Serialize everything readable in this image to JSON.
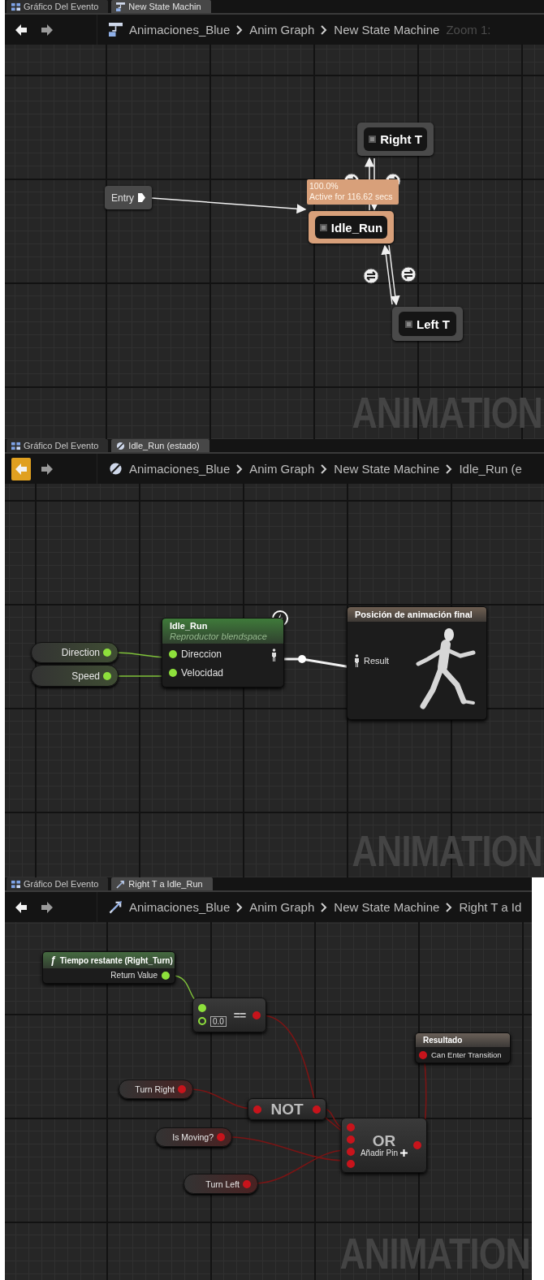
{
  "panels": [
    {
      "kind": "state_machine",
      "tabs": [
        {
          "kind": "event_graph",
          "label": "Gráfico Del Evento",
          "selected": false
        },
        {
          "kind": "state_machine",
          "label": "New State Machin",
          "selected": true
        }
      ],
      "nav": {
        "back_highlighted": false
      },
      "breadcrumbs": [
        "Animaciones_Blue",
        "Anim Graph",
        "New State Machine"
      ],
      "zoom": "Zoom 1:",
      "watermark": "ANIMATION",
      "nodes": [
        {
          "kind": "entry",
          "label": "Entry"
        },
        {
          "kind": "state",
          "label": "Right T",
          "active": false
        },
        {
          "kind": "state",
          "label": "Idle_Run",
          "active": true,
          "status": [
            "100.0%",
            "Active for 116.62 secs"
          ]
        },
        {
          "kind": "state",
          "label": "Left T",
          "active": false
        }
      ]
    },
    {
      "kind": "state",
      "tabs": [
        {
          "kind": "event_graph",
          "label": "Gráfico Del Evento",
          "selected": false
        },
        {
          "kind": "state",
          "label": "Idle_Run (estado)",
          "selected": true
        }
      ],
      "nav": {
        "back_highlighted": true
      },
      "breadcrumbs": [
        "Animaciones_Blue",
        "Anim Graph",
        "New State Machine",
        "Idle_Run (e"
      ],
      "watermark": "ANIMATION",
      "nodes": [
        {
          "kind": "variable",
          "label": "Direction",
          "pin": {
            "kind": "float"
          }
        },
        {
          "kind": "variable",
          "label": "Speed",
          "pin": {
            "kind": "float"
          }
        },
        {
          "kind": "blendspace",
          "title": "Idle_Run",
          "subtitle": "Reproductor blendspace",
          "pins": [
            "Direccion",
            "Velocidad"
          ]
        },
        {
          "kind": "output_pose",
          "title": "Posición de animación final",
          "pin": "Result"
        }
      ]
    },
    {
      "kind": "transition",
      "tabs": [
        {
          "kind": "event_graph",
          "label": "Gráfico Del Evento",
          "selected": false
        },
        {
          "kind": "transition",
          "label": "Right T a Idle_Run",
          "selected": true
        }
      ],
      "nav": {
        "back_highlighted": false
      },
      "breadcrumbs": [
        "Animaciones_Blue",
        "Anim Graph",
        "New State Machine",
        "Right T a Id"
      ],
      "watermark": "ANIMATION",
      "nodes": [
        {
          "kind": "function",
          "icon": "ƒ",
          "title": "Tiempo restante (Right_Turn)",
          "pin": "Return Value"
        },
        {
          "kind": "compare",
          "value": "0.0",
          "operator": "=="
        },
        {
          "kind": "result",
          "title": "Resultado",
          "pin": "Can Enter Transition"
        },
        {
          "kind": "variable",
          "label": "Turn Right",
          "pin": {
            "kind": "bool"
          }
        },
        {
          "kind": "logic",
          "label": "NOT",
          "inputs": [
            {
              "kind": "bool"
            }
          ]
        },
        {
          "kind": "variable",
          "label": "Is Moving?",
          "pin": {
            "kind": "bool"
          }
        },
        {
          "kind": "logic",
          "label": "OR",
          "inputs": [
            {
              "kind": "bool"
            },
            {
              "kind": "bool"
            },
            {
              "kind": "bool"
            },
            {
              "kind": "bool"
            }
          ],
          "add_pin": "Añadir Pin"
        },
        {
          "kind": "variable",
          "label": "Turn Left",
          "pin": {
            "kind": "bool"
          }
        }
      ]
    }
  ]
}
